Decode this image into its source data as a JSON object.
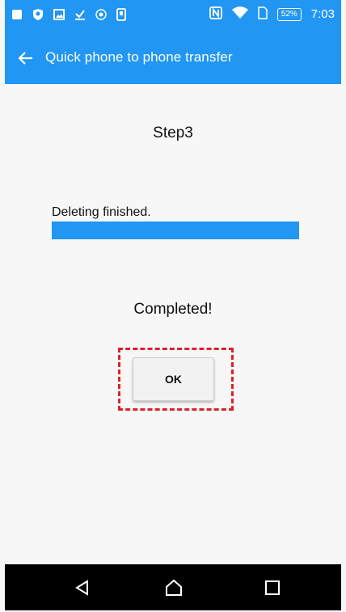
{
  "status_bar": {
    "battery_percent": "52%",
    "time": "7:03",
    "icons": [
      "square-icon",
      "shield-icon",
      "image-icon",
      "download-check-icon",
      "record-icon",
      "phone-icon",
      "nfc-icon",
      "wifi-icon",
      "sim-icon",
      "battery-icon"
    ]
  },
  "app_bar": {
    "title": "Quick phone to phone transfer",
    "back_icon": "arrow-left-icon"
  },
  "main": {
    "step_title": "Step3",
    "progress_label": "Deleting finished.",
    "progress_fraction": 1.0,
    "status_text": "Completed!",
    "ok_label": "OK"
  },
  "nav_bar": {
    "icons": [
      "back-triangle-icon",
      "home-icon",
      "recents-square-icon"
    ]
  },
  "colors": {
    "accent": "#2196f3",
    "highlight": "#d9232d",
    "nav_background": "#000000"
  }
}
